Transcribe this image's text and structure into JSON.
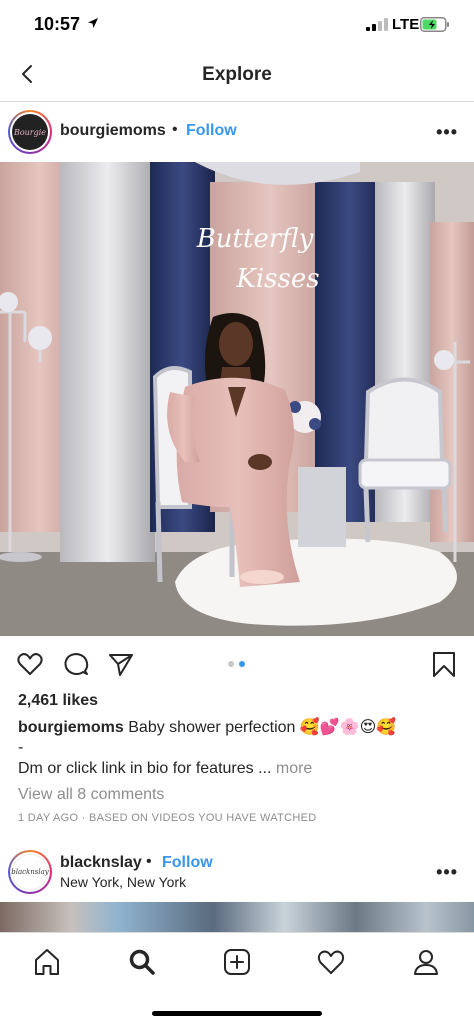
{
  "status_bar": {
    "time": "10:57",
    "carrier": "LTE"
  },
  "nav": {
    "title": "Explore"
  },
  "post": {
    "username": "bourgiemoms",
    "avatar_text": "Bourgie",
    "separator": "•",
    "follow_label": "Follow",
    "more_label": "•••",
    "image_text_line1": "Butterfly",
    "image_text_line2": "Kisses",
    "carousel": {
      "count": 2,
      "active": 2
    },
    "likes": "2,461 likes",
    "caption_username": "bourgiemoms",
    "caption_text": "Baby shower perfection 🥰💕🌸😍🥰",
    "caption_dash": "-",
    "caption_line2": "Dm or click link in bio for features ...",
    "more_link": "more",
    "comments_link": "View all 8 comments",
    "timestamp": "1 DAY AGO · BASED ON VIDEOS YOU HAVE WATCHED"
  },
  "post2": {
    "username": "blacknslay",
    "avatar_text": "blacknslay",
    "separator": "•",
    "follow_label": "Follow",
    "location": "New York, New York",
    "more_label": "•••"
  },
  "tab_bar": {
    "items": [
      {
        "icon": "home-icon"
      },
      {
        "icon": "search-icon",
        "active": true
      },
      {
        "icon": "new-post-icon"
      },
      {
        "icon": "heart-icon"
      },
      {
        "icon": "profile-icon"
      }
    ]
  },
  "colors": {
    "link_blue": "#3897f0",
    "text": "#262626",
    "muted": "#8e8e8e",
    "divider": "#dbdbdb"
  }
}
